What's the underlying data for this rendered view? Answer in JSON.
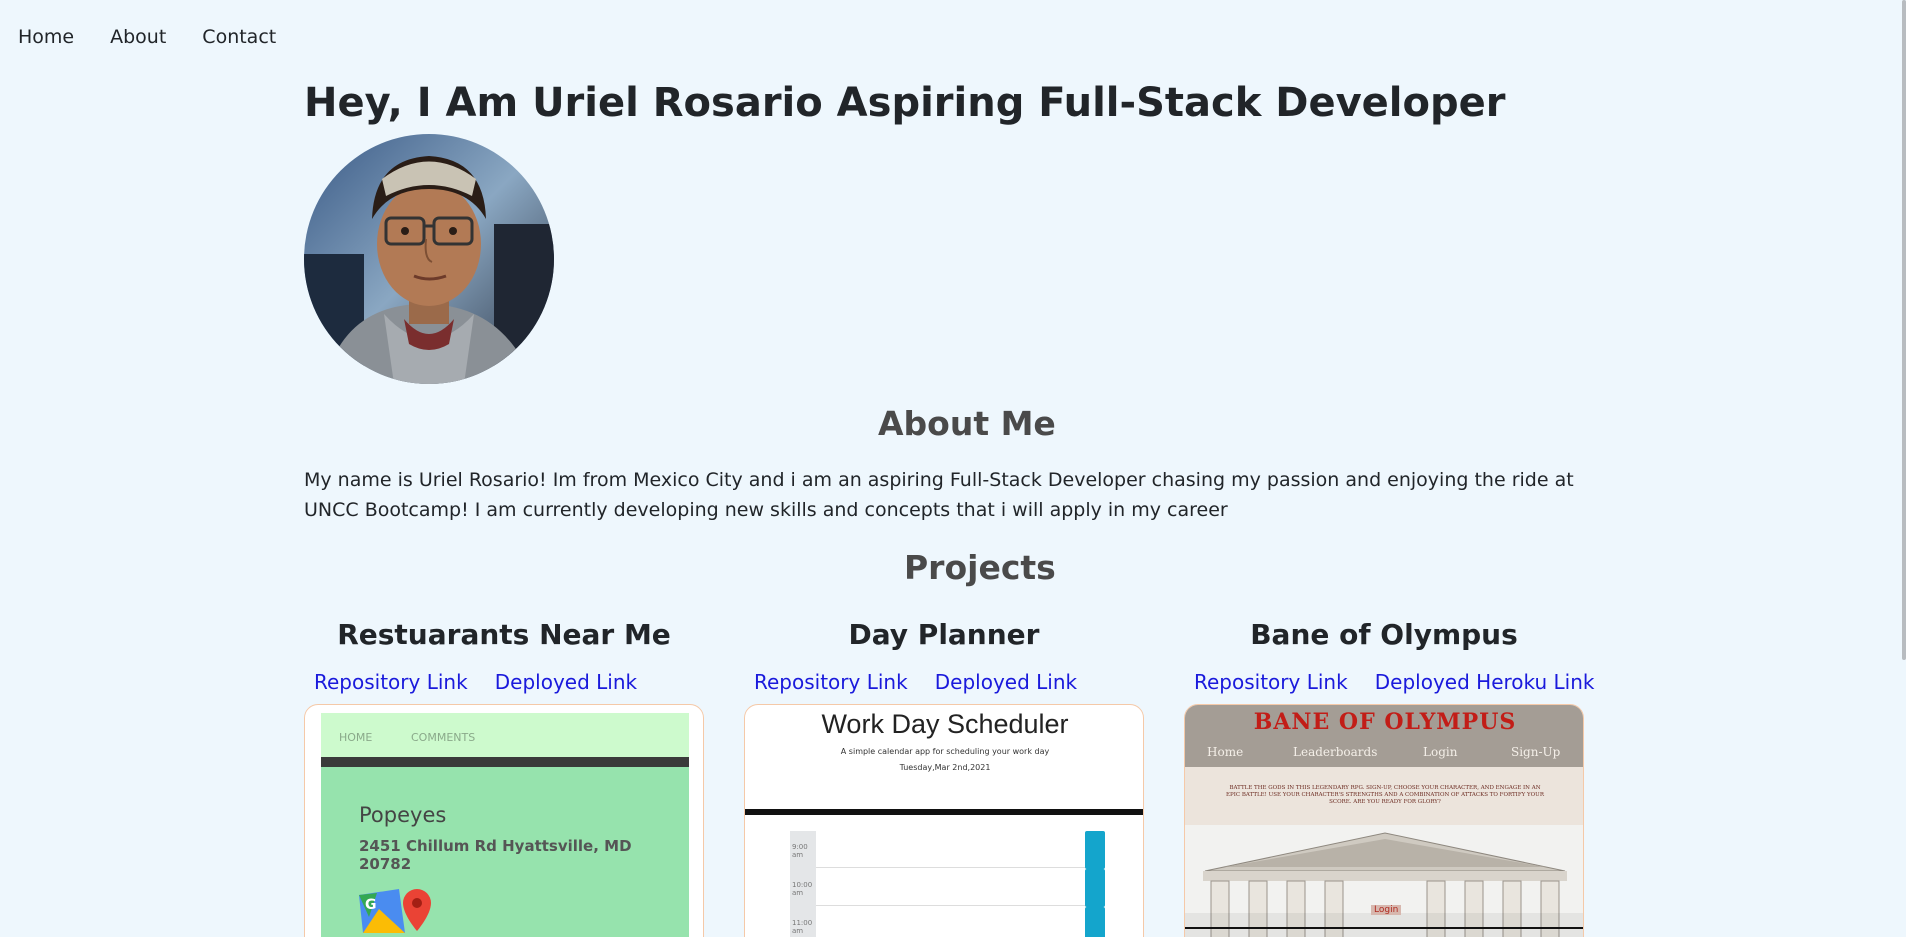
{
  "nav": {
    "items": [
      "Home",
      "About",
      "Contact"
    ]
  },
  "hero": {
    "title": "Hey, I Am Uriel Rosario Aspiring Full-Stack Developer"
  },
  "about": {
    "heading": "About Me",
    "text": "My name is Uriel Rosario! Im from Mexico City and i am an aspiring Full-Stack Developer chasing my passion and enjoying the ride at UNCC Bootcamp! I am currently developing new skills and concepts that i will apply in my career"
  },
  "projects": {
    "heading": "Projects",
    "items": [
      {
        "title": "Restuarants Near Me",
        "repo_label": "Repository Link",
        "deploy_label": "Deployed Link",
        "preview": {
          "nav1": "HOME",
          "nav2": "COMMENTS",
          "name": "Popeyes",
          "address": "2451 Chillum Rd Hyattsville, MD 20782"
        }
      },
      {
        "title": "Day Planner",
        "repo_label": "Repository Link",
        "deploy_label": "Deployed Link",
        "preview": {
          "heading": "Work Day Scheduler",
          "sub": "A simple calendar app for scheduling your work day",
          "date": "Tuesday,Mar 2nd,2021",
          "hours": [
            "9:00 am",
            "10:00 am",
            "11:00 am"
          ]
        }
      },
      {
        "title": "Bane of Olympus",
        "repo_label": "Repository Link",
        "deploy_label": "Deployed Heroku Link",
        "preview": {
          "heading": "BANE OF OLYMPUS",
          "nav": [
            "Home",
            "Leaderboards",
            "Login",
            "Sign-Up"
          ],
          "blurb": "BATTLE THE GODS IN THIS LEGENDARY RPG. SIGN-UP, CHOOSE YOUR CHARACTER, AND ENGAGE IN AN EPIC BATTLE! USE YOUR CHARACTER'S STRENGTHS AND A COMBINATION OF ATTACKS TO FORTIFY YOUR SCORE. ARE YOU READY FOR GLORY?",
          "button": "Login"
        }
      }
    ]
  }
}
